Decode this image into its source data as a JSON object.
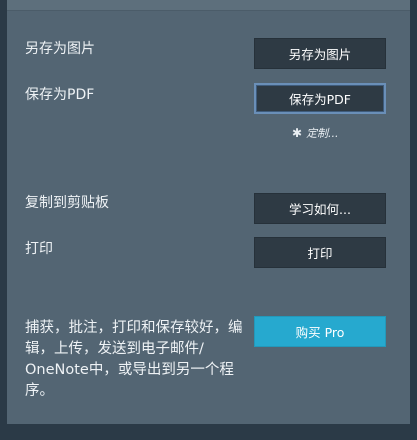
{
  "actions": {
    "save_as_image": {
      "label": "另存为图片",
      "button": "另存为图片"
    },
    "save_as_pdf": {
      "label": "保存为PDF",
      "button": "保存为PDF",
      "customize": "定制..."
    },
    "copy_to_clipboard": {
      "label": "复制到剪贴板",
      "button": "学习如何..."
    },
    "print": {
      "label": "打印",
      "button": "打印"
    }
  },
  "upgrade": {
    "description": "捕获，批注，打印和保存较好，编辑，上传，发送到电子邮件/ OneNote中，或导出到另一个程序。",
    "button": "购买 Pro"
  },
  "icons": {
    "customize": "gear-icon"
  },
  "colors": {
    "panel": "#536573",
    "button": "#2e3a44",
    "pro_button": "#26a9cf",
    "focus_border": "#6a8fb8"
  }
}
